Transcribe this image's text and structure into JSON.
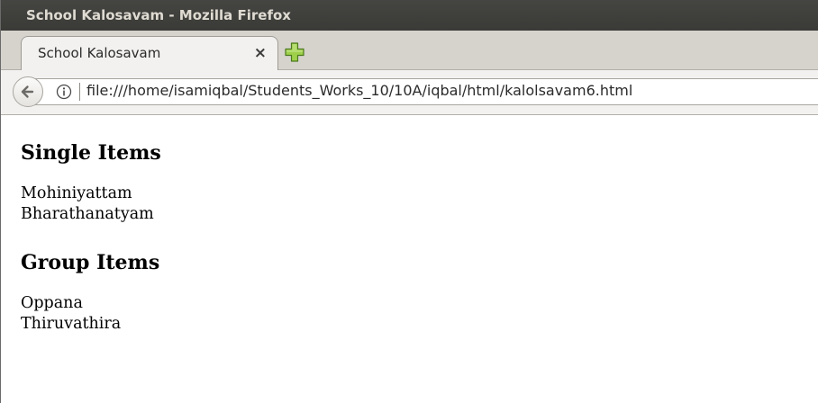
{
  "window": {
    "title": "School Kalosavam - Mozilla Firefox"
  },
  "tab": {
    "title": "School Kalosavam",
    "close_glyph": "×"
  },
  "navbar": {
    "url": "file:///home/isamiqbal/Students_Works_10/10A/iqbal/html/kalolsavam6.html"
  },
  "page": {
    "sections": [
      {
        "heading": "Single Items",
        "items": [
          "Mohiniyattam",
          "Bharathanatyam"
        ]
      },
      {
        "heading": "Group Items",
        "items": [
          "Oppana",
          "Thiruvathira"
        ]
      }
    ]
  },
  "colors": {
    "titlebar_bg": "#3d3d3a",
    "tab_strip_bg": "#d6d3cd",
    "newtab_plus": "#8fc43b"
  }
}
